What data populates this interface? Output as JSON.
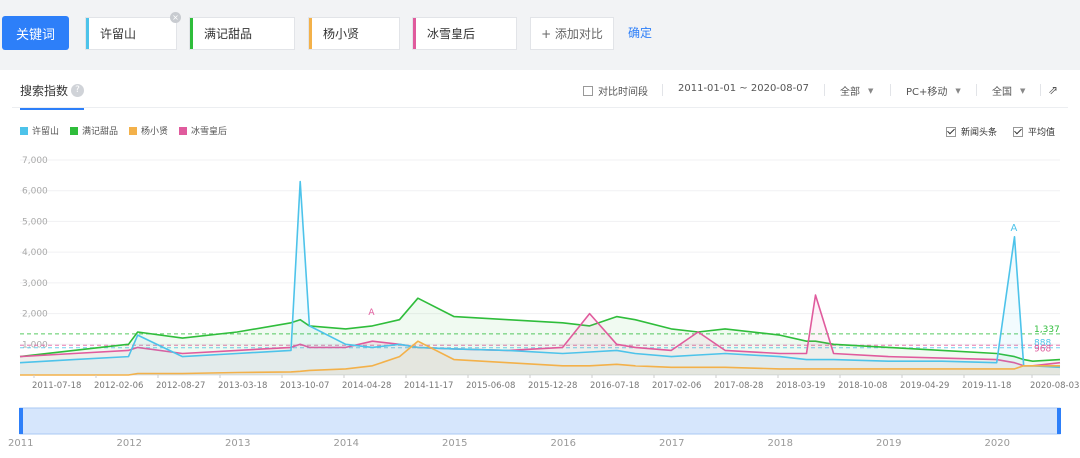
{
  "header": {
    "keyword_label": "关键词",
    "terms": [
      {
        "label": "许留山",
        "color": "#4dc3ea"
      },
      {
        "label": "满记甜品",
        "color": "#2fbd3b"
      },
      {
        "label": "杨小贤",
        "color": "#f3b14a"
      },
      {
        "label": "冰雪皇后",
        "color": "#e05b9d"
      }
    ],
    "close_glyph": "×",
    "add_label": "+ 添加对比",
    "confirm_label": "确定"
  },
  "toolbar": {
    "tab_label": "搜索指数",
    "help_glyph": "?",
    "compare_label": "对比时间段",
    "date_range": "2011-01-01 ~ 2020-08-07",
    "scope": "全部",
    "device": "PC+移动",
    "region": "全国",
    "caret": "▼",
    "export_glyph": "⇗",
    "news_label": "新闻头条",
    "avg_label": "平均值"
  },
  "chart_data": {
    "type": "line",
    "y_ticks": [
      "7,000",
      "6,000",
      "5,000",
      "4,000",
      "3,000",
      "2,000",
      "1,000"
    ],
    "ylim": [
      0,
      7000
    ],
    "x_tick_labels": [
      "2011-07-18",
      "2012-02-06",
      "2012-08-27",
      "2013-03-18",
      "2013-10-07",
      "2014-04-28",
      "2014-11-17",
      "2015-06-08",
      "2015-12-28",
      "2016-07-18",
      "2017-02-06",
      "2017-08-28",
      "2018-03-19",
      "2018-10-08",
      "2019-04-29",
      "2019-11-18",
      "2020-08-03"
    ],
    "x_dates": [
      "2011-01",
      "2011-07",
      "2012-01",
      "2012-02",
      "2012-07",
      "2013-01",
      "2013-07",
      "2013-08",
      "2013-09",
      "2014-01",
      "2014-04",
      "2014-07",
      "2014-09",
      "2015-01",
      "2015-07",
      "2016-01",
      "2016-04",
      "2016-07",
      "2016-09",
      "2017-01",
      "2017-04",
      "2017-07",
      "2018-01",
      "2018-04",
      "2018-05",
      "2018-07",
      "2019-01",
      "2019-07",
      "2020-01",
      "2020-03",
      "2020-04",
      "2020-05",
      "2020-08"
    ],
    "series": [
      {
        "name": "许留山",
        "color": "#4dc3ea",
        "values": [
          400,
          500,
          600,
          1300,
          600,
          700,
          800,
          6300,
          1600,
          1000,
          900,
          1000,
          900,
          850,
          800,
          700,
          750,
          800,
          700,
          600,
          650,
          700,
          600,
          500,
          500,
          500,
          450,
          450,
          400,
          4500,
          300,
          300,
          250
        ]
      },
      {
        "name": "满记甜品",
        "color": "#2fbd3b",
        "values": [
          600,
          800,
          1000,
          1400,
          1200,
          1400,
          1700,
          1800,
          1600,
          1500,
          1600,
          1800,
          2500,
          1900,
          1800,
          1700,
          1600,
          1900,
          1800,
          1500,
          1400,
          1500,
          1300,
          1100,
          1100,
          1000,
          900,
          800,
          700,
          600,
          500,
          450,
          500
        ]
      },
      {
        "name": "杨小贤",
        "color": "#f3b14a",
        "values": [
          0,
          0,
          0,
          50,
          50,
          80,
          100,
          120,
          150,
          200,
          300,
          600,
          1100,
          500,
          400,
          300,
          300,
          350,
          300,
          250,
          250,
          250,
          200,
          200,
          200,
          200,
          200,
          200,
          200,
          200,
          300,
          300,
          300
        ]
      },
      {
        "name": "冰雪皇后",
        "color": "#e05b9d",
        "values": [
          600,
          700,
          800,
          900,
          700,
          800,
          900,
          1000,
          900,
          900,
          1100,
          1000,
          900,
          850,
          800,
          900,
          2000,
          1000,
          900,
          800,
          1400,
          800,
          700,
          700,
          2600,
          700,
          600,
          550,
          500,
          400,
          300,
          300,
          400
        ]
      }
    ],
    "avg_labels": [
      "1,337",
      "888",
      "968"
    ],
    "avg_values": [
      1337,
      888,
      968
    ],
    "avg_colors": [
      "#2fbd3b",
      "#4dc3ea",
      "#e05b9d"
    ],
    "news_marker": "A",
    "navigator_years": [
      "2011",
      "2012",
      "2013",
      "2014",
      "2015",
      "2016",
      "2017",
      "2018",
      "2019",
      "2020"
    ]
  }
}
